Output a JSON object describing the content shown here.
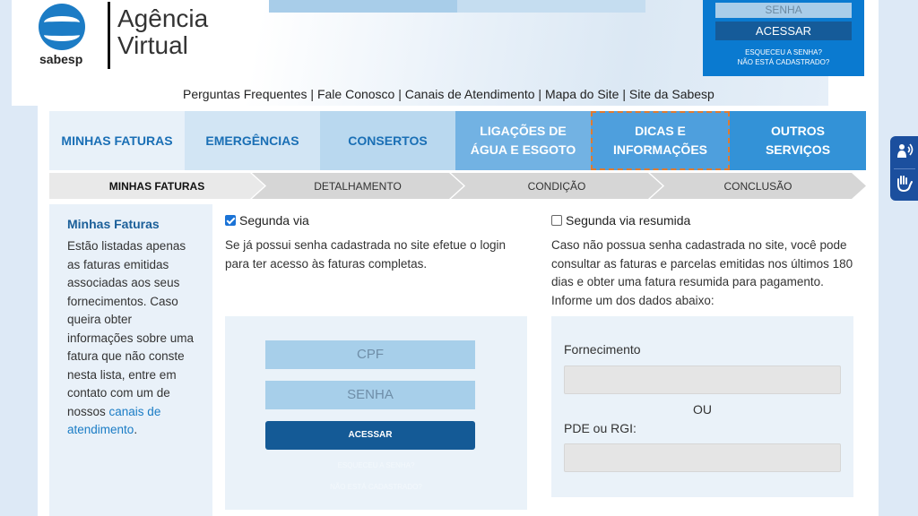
{
  "header": {
    "logo_text": "sabesp",
    "title_line1": "Agência",
    "title_line2": "Virtual",
    "quick_links": [
      "Perguntas Frequentes",
      "Fale Conosco",
      "Canais de Atendimento",
      "Mapa do Site",
      "Site da Sabesp"
    ],
    "separator": " | "
  },
  "login": {
    "password_placeholder": "SENHA",
    "submit_label": "ACESSAR",
    "forgot_label": "ESQUECEU A SENHA?",
    "register_label": "NÃO ESTÁ CADASTRADO?"
  },
  "nav": [
    {
      "line1": "MINHAS FATURAS",
      "line2": ""
    },
    {
      "line1": "EMERGÊNCIAS",
      "line2": ""
    },
    {
      "line1": "CONSERTOS",
      "line2": ""
    },
    {
      "line1": "LIGAÇÕES DE",
      "line2": "ÁGUA E ESGOTO"
    },
    {
      "line1": "DICAS E",
      "line2": "INFORMAÇÕES"
    },
    {
      "line1": "OUTROS",
      "line2": "SERVIÇOS"
    }
  ],
  "steps": [
    "MINHAS FATURAS",
    "DETALHAMENTO",
    "CONDIÇÃO",
    "CONCLUSÃO"
  ],
  "sidebar": {
    "title": "Minhas Faturas",
    "text": "Estão listadas apenas as faturas emitidas associadas aos seus fornecimentos. Caso queira obter informações sobre uma fatura que não conste nesta lista, entre em contato com um de nossos ",
    "link": "canais de atendimento",
    "end": "."
  },
  "option_full": {
    "label": "Segunda via",
    "checked": true,
    "description": "Se já possui senha cadastrada no site efetue o login para ter acesso às faturas completas.",
    "cpf_placeholder": "CPF",
    "senha_placeholder": "SENHA",
    "button": "ACESSAR",
    "forgot": "ESQUECEU A SENHA?",
    "register": "NÃO ESTÁ CADASTRADO?"
  },
  "option_summary": {
    "label": "Segunda via resumida",
    "checked": false,
    "description": "Caso não possua senha cadastrada no site, você pode consultar as faturas e parcelas emitidas nos últimos 180 dias e obter uma fatura resumida para pagamento. Informe um dos dados abaixo:",
    "field1_label": "Fornecimento",
    "or_label": "OU",
    "field2_label": "PDE ou RGI:"
  },
  "colors": {
    "brand_blue": "#0a7ad0",
    "button_dark": "#145a96",
    "highlight_border": "#e07b30"
  },
  "accessibility": {
    "icons": [
      "audio-description-icon",
      "sign-language-icon"
    ]
  }
}
